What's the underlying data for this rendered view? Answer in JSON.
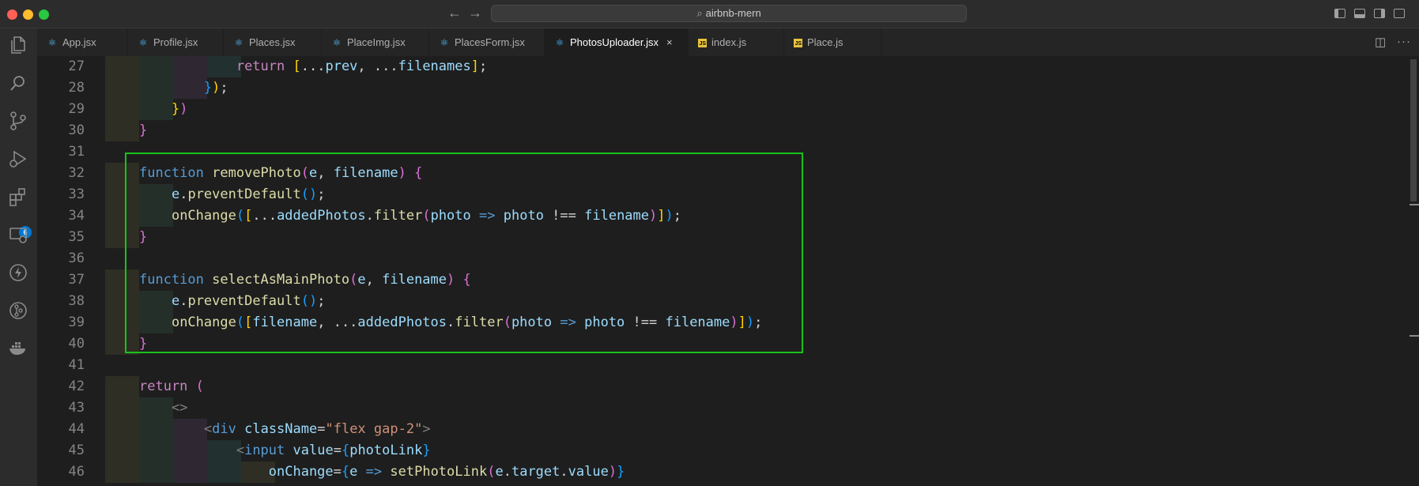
{
  "window": {
    "search_text": "airbnb-mern",
    "traffic_lights": [
      "#ff5f57",
      "#febc2e",
      "#28c840"
    ]
  },
  "activity_bar": {
    "icons": [
      "files-icon",
      "search-icon",
      "source-control-icon",
      "run-debug-icon",
      "extensions-icon",
      "remote-explorer-icon",
      "thunder-client-icon",
      "gitlens-icon",
      "docker-icon"
    ],
    "extensions_badge": "6"
  },
  "tabs": [
    {
      "label": "App.jsx",
      "icon": "react-icon",
      "active": false
    },
    {
      "label": "Profile.jsx",
      "icon": "react-icon",
      "active": false
    },
    {
      "label": "Places.jsx",
      "icon": "react-icon",
      "active": false
    },
    {
      "label": "PlaceImg.jsx",
      "icon": "react-icon",
      "active": false
    },
    {
      "label": "PlacesForm.jsx",
      "icon": "react-icon",
      "active": false
    },
    {
      "label": "PhotosUploader.jsx",
      "icon": "react-icon",
      "active": true,
      "close": "×"
    },
    {
      "label": "index.js",
      "icon": "js-icon",
      "active": false
    },
    {
      "label": "Place.js",
      "icon": "js-icon",
      "active": false
    }
  ],
  "editor": {
    "lines": [
      {
        "num": "27",
        "text": "            return [...prev, ...filenames];"
      },
      {
        "num": "28",
        "text": "        });"
      },
      {
        "num": "29",
        "text": "    })"
      },
      {
        "num": "30",
        "text": "}"
      },
      {
        "num": "31",
        "text": ""
      },
      {
        "num": "32",
        "text": "function removePhoto(e, filename) {"
      },
      {
        "num": "33",
        "text": "    e.preventDefault();"
      },
      {
        "num": "34",
        "text": "    onChange([...addedPhotos.filter(photo => photo !== filename)]);"
      },
      {
        "num": "35",
        "text": "}"
      },
      {
        "num": "36",
        "text": ""
      },
      {
        "num": "37",
        "text": "function selectAsMainPhoto(e, filename) {"
      },
      {
        "num": "38",
        "text": "    e.preventDefault();"
      },
      {
        "num": "39",
        "text": "    onChange([filename, ...addedPhotos.filter(photo => photo !== filename)]);"
      },
      {
        "num": "40",
        "text": "}"
      },
      {
        "num": "41",
        "text": ""
      },
      {
        "num": "42",
        "text": "return ("
      },
      {
        "num": "43",
        "text": "    <>"
      },
      {
        "num": "44",
        "text": "        <div className=\"flex gap-2\">"
      },
      {
        "num": "45",
        "text": "            <input value={photoLink}"
      },
      {
        "num": "46",
        "text": "                onChange={e => setPhotoLink(e.target.value)}"
      }
    ]
  }
}
